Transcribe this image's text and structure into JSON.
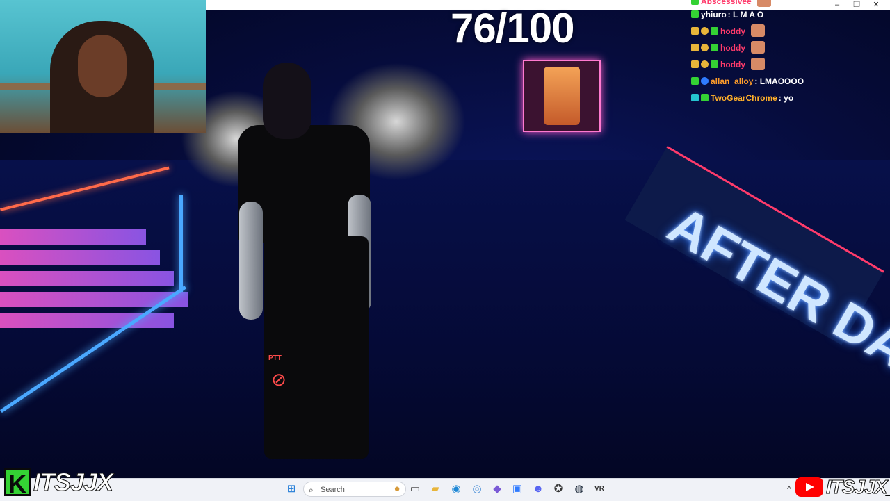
{
  "stream": {
    "counter": "76/100",
    "sign_text": "AFTER DARK",
    "ptt_label": "PTT"
  },
  "window_controls": [
    "–",
    "❐",
    "✕"
  ],
  "chat": {
    "lines": [
      {
        "user": "Abscessivee",
        "message": "",
        "user_color": "#ff3b6b",
        "badges": [
          "diamond-icon"
        ],
        "emote": true
      },
      {
        "user": "yhiuro",
        "message": "L M A O",
        "user_color": "#ffffff",
        "badges": [
          "diamond-icon"
        ],
        "emote": false
      },
      {
        "user": "hoddy",
        "message": "",
        "user_color": "#ff3b6b",
        "badges": [
          "crown-icon",
          "star-icon",
          "diamond-icon"
        ],
        "emote": true
      },
      {
        "user": "hoddy",
        "message": "",
        "user_color": "#ff3b6b",
        "badges": [
          "crown-icon",
          "star-icon",
          "diamond-icon"
        ],
        "emote": true
      },
      {
        "user": "hoddy",
        "message": "",
        "user_color": "#ff3b6b",
        "badges": [
          "crown-icon",
          "star-icon",
          "diamond-icon"
        ],
        "emote": true
      },
      {
        "user": "allan_alloy",
        "message": "LMAOOOO",
        "user_color": "#ff9c2a",
        "badges": [
          "diamond-icon",
          "globe-icon"
        ],
        "emote": false
      },
      {
        "user": "TwoGearChrome",
        "message": "yo",
        "user_color": "#ffb02a",
        "badges": [
          "grid-icon",
          "diamond-icon"
        ],
        "emote": false
      }
    ],
    "colors": {
      "crown": "#e8b53a",
      "star": "#e8b53a",
      "diamond": "#34d234",
      "globe": "#2f7bff",
      "grid": "#25c4d0"
    }
  },
  "branding": {
    "left_logo_letter": "K",
    "left_channel": "ITSJJX",
    "right_channel": "ITSJJX_"
  },
  "taskbar": {
    "search_placeholder": "Search",
    "icons": [
      "windows-start-icon",
      "search-icon",
      "widget-icon",
      "task-view-icon",
      "file-explorer-icon",
      "edge-icon",
      "chrome-icon",
      "app-icon",
      "store-icon",
      "discord-icon",
      "app2-icon",
      "steam-icon",
      "vr-icon"
    ],
    "tray_chevron": "^"
  }
}
